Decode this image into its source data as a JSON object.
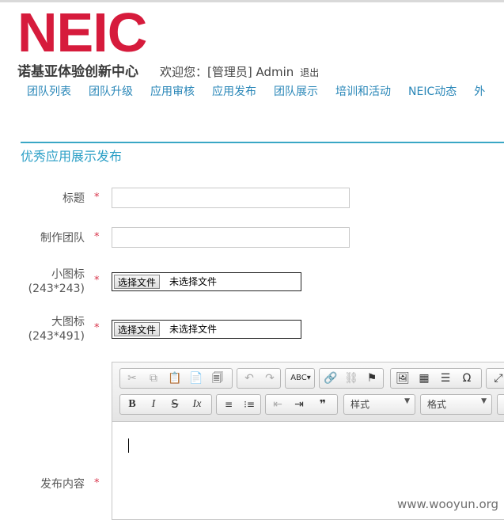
{
  "logo": {
    "text": "NEIC",
    "subtitle": "诺基亚体验创新中心"
  },
  "welcome": {
    "text": "欢迎您：[管理员] Admin",
    "logout": "退出"
  },
  "nav": [
    "团队列表",
    "团队升级",
    "应用审核",
    "应用发布",
    "团队展示",
    "培训和活动",
    "NEIC动态",
    "外"
  ],
  "section_title": "优秀应用展示发布",
  "form": {
    "required_mark": "*",
    "title_label": "标题",
    "team_label": "制作团队",
    "small_icon_label": "小图标",
    "small_icon_size": "(243*243)",
    "large_icon_label": "大图标",
    "large_icon_size": "(243*491)",
    "file_button": "选择文件",
    "file_status": "未选择文件",
    "content_label": "发布内容"
  },
  "editor": {
    "style_combo": "样式",
    "format_combo": "格式",
    "spell_label": "ABC"
  },
  "watermark": "www.wooyun.org"
}
